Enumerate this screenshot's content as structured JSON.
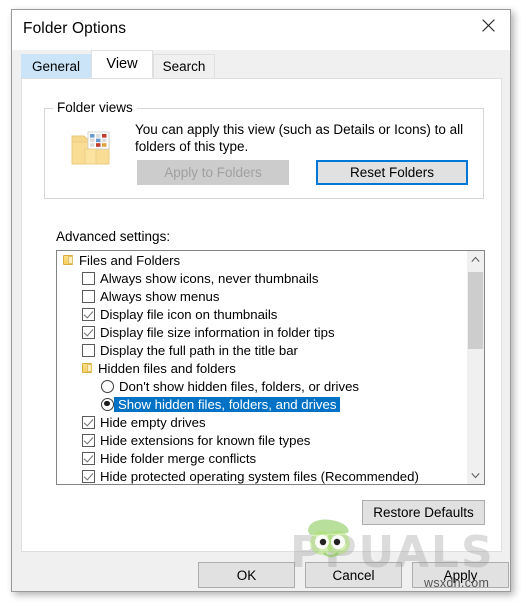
{
  "window": {
    "title": "Folder Options",
    "close_icon": "close-icon"
  },
  "tabs": [
    {
      "label": "General",
      "state": "hover"
    },
    {
      "label": "View",
      "state": "active"
    },
    {
      "label": "Search",
      "state": "plain"
    }
  ],
  "folder_views": {
    "legend": "Folder views",
    "icon": "folder-with-thumbnails-icon",
    "description": "You can apply this view (such as Details or Icons) to all folders of this type.",
    "apply_button": "Apply to Folders",
    "apply_button_disabled": true,
    "reset_button": "Reset Folders",
    "reset_button_focused": true
  },
  "advanced": {
    "label": "Advanced settings:",
    "items": [
      {
        "type": "folder",
        "indent": 0,
        "label": "Files and Folders",
        "checked": false,
        "selected": false
      },
      {
        "type": "checkbox",
        "indent": 1,
        "label": "Always show icons, never thumbnails",
        "checked": false,
        "selected": false
      },
      {
        "type": "checkbox",
        "indent": 1,
        "label": "Always show menus",
        "checked": false,
        "selected": false
      },
      {
        "type": "checkbox",
        "indent": 1,
        "label": "Display file icon on thumbnails",
        "checked": true,
        "selected": false
      },
      {
        "type": "checkbox",
        "indent": 1,
        "label": "Display file size information in folder tips",
        "checked": true,
        "selected": false
      },
      {
        "type": "checkbox",
        "indent": 1,
        "label": "Display the full path in the title bar",
        "checked": false,
        "selected": false
      },
      {
        "type": "folder",
        "indent": 1,
        "label": "Hidden files and folders",
        "checked": false,
        "selected": false
      },
      {
        "type": "radio",
        "indent": 2,
        "label": "Don't show hidden files, folders, or drives",
        "checked": false,
        "selected": false
      },
      {
        "type": "radio",
        "indent": 2,
        "label": "Show hidden files, folders, and drives",
        "checked": true,
        "selected": true
      },
      {
        "type": "checkbox",
        "indent": 1,
        "label": "Hide empty drives",
        "checked": true,
        "selected": false
      },
      {
        "type": "checkbox",
        "indent": 1,
        "label": "Hide extensions for known file types",
        "checked": true,
        "selected": false
      },
      {
        "type": "checkbox",
        "indent": 1,
        "label": "Hide folder merge conflicts",
        "checked": true,
        "selected": false
      },
      {
        "type": "checkbox",
        "indent": 1,
        "label": "Hide protected operating system files (Recommended)",
        "checked": true,
        "selected": false
      }
    ],
    "scroll_up_icon": "chevron-up-icon",
    "scroll_down_icon": "chevron-down-icon",
    "restore_button": "Restore Defaults"
  },
  "footer": {
    "ok": "OK",
    "cancel": "Cancel",
    "apply": "Apply"
  },
  "watermark": {
    "brand": "PPUALS",
    "site": "wsxdn.com"
  },
  "colors": {
    "selection": "#0072c6",
    "focus_border": "#0078d7",
    "tab_hover": "#cce4f7",
    "dialog_bg": "#f0f0f0",
    "button_bg": "#e1e1e1"
  }
}
